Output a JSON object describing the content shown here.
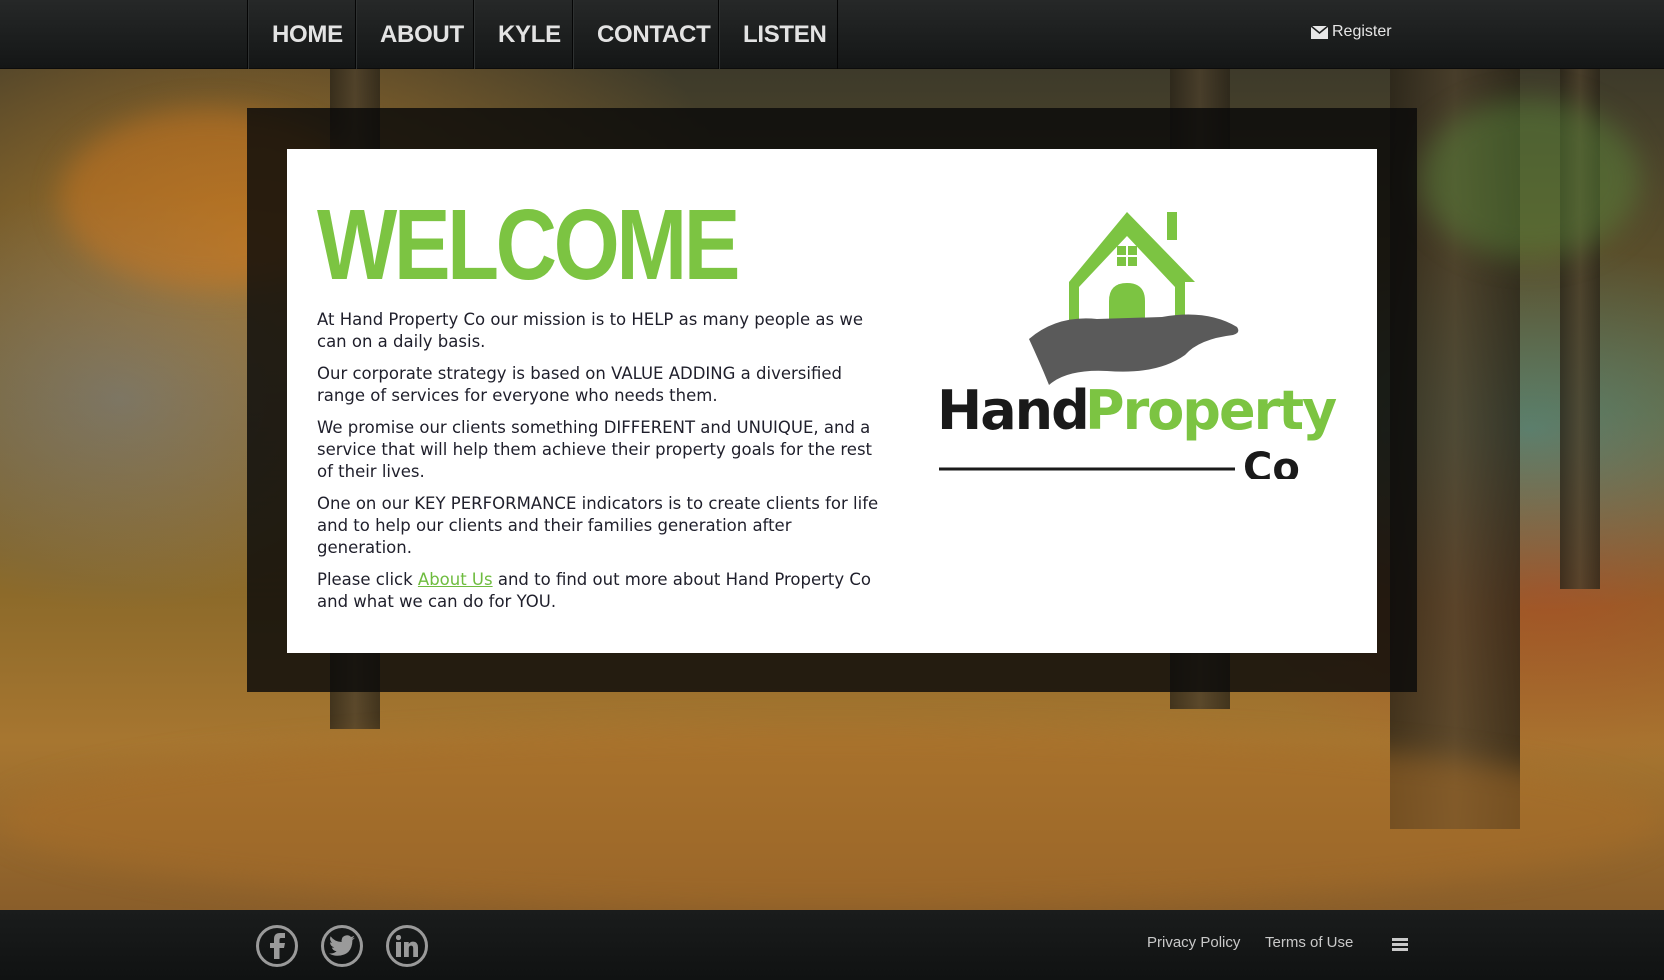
{
  "nav": {
    "items": [
      {
        "label": "HOME"
      },
      {
        "label": "ABOUT"
      },
      {
        "label": "KYLE"
      },
      {
        "label": "CONTACT"
      },
      {
        "label": "LISTEN"
      }
    ],
    "register_label": "Register",
    "register_icon": "envelope-icon"
  },
  "main": {
    "heading": "WELCOME",
    "paragraphs": [
      "At Hand Property Co our mission is to HELP as many people as we can on a daily basis.",
      "Our corporate strategy is based on VALUE ADDING a diversified range of services for everyone who needs them.",
      "We promise our clients something DIFFERENT and UNUIQUE, and a service that will help them achieve their property goals for the rest of their lives.",
      "One on our KEY PERFORMANCE indicators is to create clients for life and to help our clients and their families generation after generation."
    ],
    "cta": {
      "before": "Please click ",
      "link": "About Us",
      "after": " and to find out more about Hand Property Co and what we can do for YOU."
    }
  },
  "logo": {
    "word_hand": "Hand",
    "word_property": "Property",
    "word_co": "Co",
    "colors": {
      "green": "#7cc442",
      "dark": "#1a1a1a",
      "hand_gray": "#5a5a5a"
    }
  },
  "footer": {
    "social": [
      "facebook-icon",
      "twitter-icon",
      "linkedin-icon"
    ],
    "privacy": "Privacy Policy",
    "terms": "Terms of Use",
    "menu_icon": "hamburger-menu-icon"
  },
  "colors": {
    "accent": "#7cc442",
    "bar": "#161818",
    "text": "#1f1f2b"
  }
}
